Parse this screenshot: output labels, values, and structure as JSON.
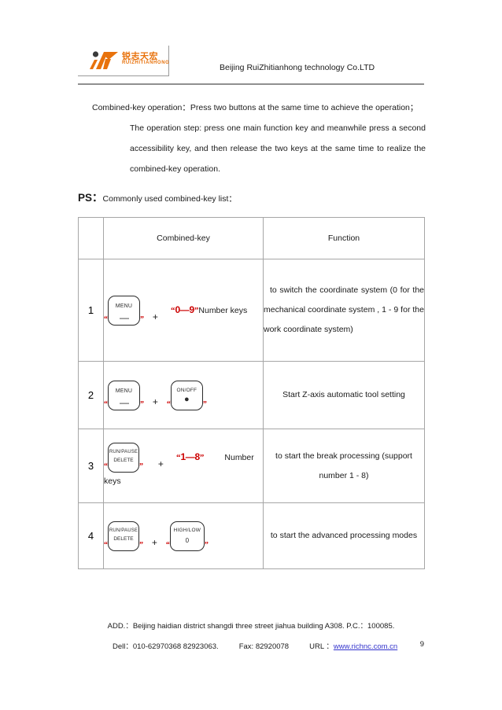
{
  "header": {
    "logo": {
      "chinese": "锐志天宏",
      "english": "RUIZHITIANHONG",
      "mark_color": "#e8720c"
    },
    "company": "Beijing RuiZhitianhong technology Co.LTD"
  },
  "intro": {
    "line1": "Combined-key operation：Press two buttons at the same time to achieve the operation；",
    "rest": "The operation step: press one main function key and meanwhile press a second accessibility key, and then release the two keys at the same time to realize the combined-key operation."
  },
  "ps": {
    "label": "PS：",
    "text": "Commonly used combined-key list："
  },
  "table": {
    "headers": {
      "num": "",
      "combined_key": "Combined-key",
      "function": "Function"
    },
    "rows": [
      {
        "num": "1",
        "keys": [
          {
            "top": "MENU",
            "bottom": "—"
          }
        ],
        "plus": "+",
        "range": "0—9",
        "range_suffix": "Number keys",
        "function": "to switch the coordinate system (0 for the mechanical coordinate system , 1 - 9 for the work coordinate system)",
        "function_align": "justify"
      },
      {
        "num": "2",
        "keys": [
          {
            "top": "MENU",
            "bottom": "—"
          },
          {
            "top": "ON/OFF",
            "bottom": "●"
          }
        ],
        "plus": "+",
        "range": "",
        "range_suffix": "",
        "function": "Start Z-axis automatic tool setting",
        "function_align": "center"
      },
      {
        "num": "3",
        "keys": [
          {
            "top": "RUN/PAUSE",
            "bottom": "DELETE"
          }
        ],
        "plus": "+",
        "range": "1—8",
        "range_suffix": "Number keys",
        "function": "to start the break processing (support number 1 - 8)",
        "function_align": "center"
      },
      {
        "num": "4",
        "keys": [
          {
            "top": "RUN/PAUSE",
            "bottom": "DELETE"
          },
          {
            "top": "HIGH/LOW",
            "bottom": "0"
          }
        ],
        "plus": "+",
        "range": "",
        "range_suffix": "",
        "function": "to start the advanced processing modes",
        "function_align": "center"
      }
    ],
    "quote_open": "“",
    "quote_close": "”",
    "quote_color": "#cc0000"
  },
  "footer": {
    "address": "ADD.：Beijing haidian district shangdi three street jiahua building A308. P.C.：100085.",
    "dell_label": "Dell：010-62970368 82923063.",
    "fax_label": "Fax: 82920078",
    "url_label": "URL ：",
    "url": "www.richnc.com.cn",
    "page": "9"
  }
}
